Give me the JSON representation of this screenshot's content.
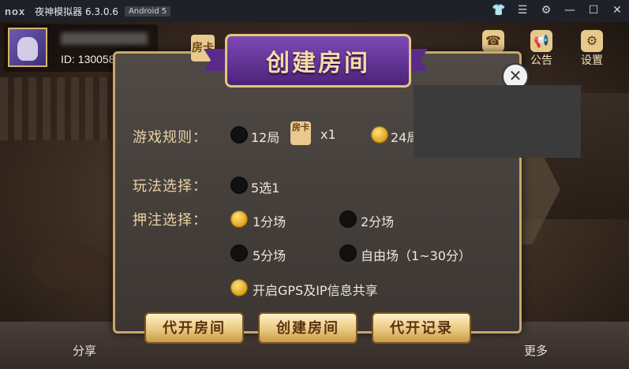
{
  "emulator": {
    "logo": "nox",
    "app_name": "夜神模拟器 6.3.0.6",
    "android_badge": "Android 5",
    "icons": [
      "shirt-icon",
      "menu-icon",
      "settings-icon",
      "minimize-icon",
      "maximize-icon",
      "close-icon"
    ]
  },
  "profile": {
    "user_id": "ID: 130058"
  },
  "top_right": [
    {
      "label": "客服",
      "icon": "customer-service-icon"
    },
    {
      "label": "公告",
      "icon": "announcement-icon"
    },
    {
      "label": "设置",
      "icon": "settings-gear-icon"
    }
  ],
  "dialog": {
    "title": "创建房间",
    "card_label": "房卡",
    "rules": {
      "label": "游戏规则：",
      "options": [
        {
          "text": "12局",
          "selected": false,
          "cost": "x1"
        },
        {
          "text": "24局",
          "selected": true
        }
      ]
    },
    "mode": {
      "label": "玩法选择：",
      "options": [
        {
          "text": "5选1",
          "selected": false
        }
      ]
    },
    "bet": {
      "label": "押注选择：",
      "options": [
        {
          "text": "1分场",
          "selected": true
        },
        {
          "text": "2分场",
          "selected": false
        },
        {
          "text": "5分场",
          "selected": false
        },
        {
          "text": "自由场（1~30分）",
          "selected": false
        }
      ]
    },
    "gps": {
      "text": "开启GPS及IP信息共享",
      "selected": true
    },
    "buttons": {
      "proxy_open": "代开房间",
      "create": "创建房间",
      "proxy_record": "代开记录"
    }
  },
  "bottom_bar": {
    "share": "分享",
    "more": "更多"
  },
  "colors": {
    "dialog_border": "#c8a86a",
    "banner_purple": "#6a36a0",
    "label_gold": "#e8d3a3",
    "radio_selected": "#e0a21c"
  }
}
